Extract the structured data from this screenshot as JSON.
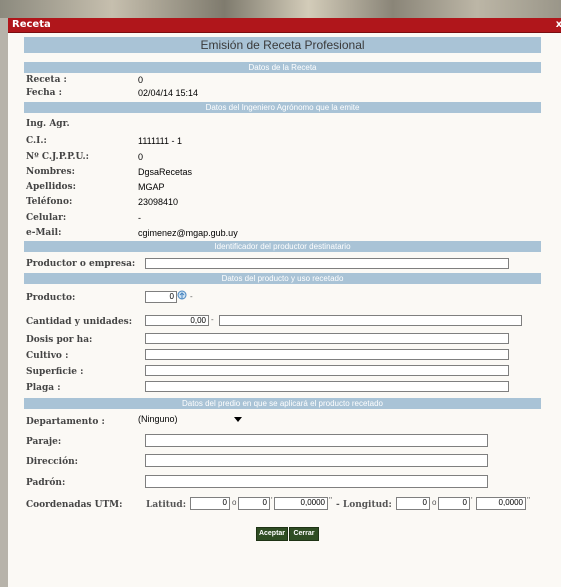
{
  "window": {
    "title": "Receta",
    "close_label": "x"
  },
  "main_title": "Emisión de Receta Profesional",
  "sections": {
    "receta": "Datos de la Receta",
    "ingeniero": "Datos del Ingeniero Agrónomo que la emite",
    "productor": "Identificador del productor destinatario",
    "producto": "Datos del producto y uso recetado",
    "predio": "Datos del predio en que se aplicará el producto recetado"
  },
  "receta": {
    "receta_label": "Receta :",
    "receta_value": "0",
    "fecha_label": "Fecha :",
    "fecha_value": "02/04/14 15:14"
  },
  "ingeniero": {
    "ing_label": "Ing. Agr.",
    "ci_label": "C.I.:",
    "ci_value": "1111111 - 1",
    "cjppu_label": "Nº C.J.P.P.U.:",
    "cjppu_value": "0",
    "nombres_label": "Nombres:",
    "nombres_value": "DgsaRecetas",
    "apellidos_label": "Apellidos:",
    "apellidos_value": "MGAP",
    "telefono_label": "Teléfono:",
    "telefono_value": "23098410",
    "celular_label": "Celular:",
    "celular_value": "-",
    "email_label": "e-Mail:",
    "email_value": "cgimenez@mgap.gub.uy"
  },
  "productor": {
    "label": "Productor o empresa:",
    "value": ""
  },
  "producto": {
    "producto_label": "Producto:",
    "producto_value": "0",
    "producto_sep": "-",
    "cantidad_label": "Cantidad y unidades:",
    "cantidad_value": "0,00",
    "cantidad_sep": "-",
    "dosis_label": "Dosis por ha:",
    "cultivo_label": "Cultivo :",
    "superficie_label": "Superficie :",
    "plaga_label": "Plaga :"
  },
  "predio": {
    "departamento_label": "Departamento :",
    "departamento_value": "(Ninguno)",
    "paraje_label": "Paraje:",
    "direccion_label": "Dirección:",
    "padron_label": "Padrón:",
    "utm_label": "Coordenadas UTM:",
    "latitud_label": "Latitud:",
    "longitud_label": "- Longitud:",
    "lat_deg": "0",
    "lat_min": "0",
    "lat_sec": "0,0000",
    "lon_deg": "0",
    "lon_min": "0",
    "lon_sec": "0,0000",
    "deg_symbol": "o",
    "min_symbol": "'",
    "sec_symbol": "''"
  },
  "buttons": {
    "accept": "Aceptar",
    "close": "Cerrar"
  },
  "colors": {
    "titlebar": "#b0161b",
    "band": "#a9c3d6",
    "button": "#2f4d23"
  }
}
